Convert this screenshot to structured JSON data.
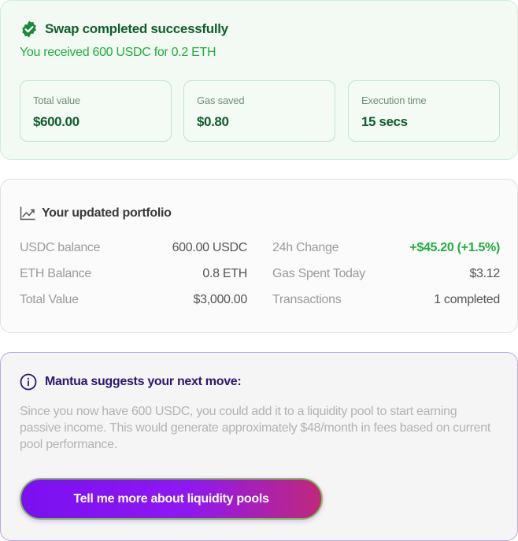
{
  "success": {
    "title": "Swap completed successfully",
    "subtitle": "You received 600 USDC for 0.2 ETH",
    "stats": [
      {
        "label": "Total value",
        "value": "$600.00"
      },
      {
        "label": "Gas saved",
        "value": "$0.80"
      },
      {
        "label": "Execution time",
        "value": "15 secs"
      }
    ],
    "icon": "check-badge-icon",
    "colors": {
      "title": "#0f5f2c",
      "subtitle": "#1fae3a",
      "background": "#f2faf3"
    }
  },
  "portfolio": {
    "title": "Your updated portfolio",
    "icon": "trend-chart-icon",
    "left": [
      {
        "label": "USDC balance",
        "value": "600.00 USDC"
      },
      {
        "label": "ETH Balance",
        "value": "0.8 ETH"
      },
      {
        "label": "Total Value",
        "value": "$3,000.00"
      }
    ],
    "right": [
      {
        "label": "24h Change",
        "value": "+$45.20 (+1.5%)"
      },
      {
        "label": "Gas Spent Today",
        "value": "$3.12"
      },
      {
        "label": "Transactions",
        "value": "1 completed"
      }
    ]
  },
  "suggestion": {
    "icon": "info-icon",
    "title": "Mantua suggests your next move:",
    "body": "Since you now have 600 USDC, you could add it to a liquidity pool to start earning passive income. This would generate approximately $48/month in fees based on current pool performance.",
    "cta_label": "Tell me more about liquidity pools",
    "colors": {
      "title": "#2d1670",
      "button_start": "#7b10f0",
      "button_end": "#c0287a"
    }
  }
}
